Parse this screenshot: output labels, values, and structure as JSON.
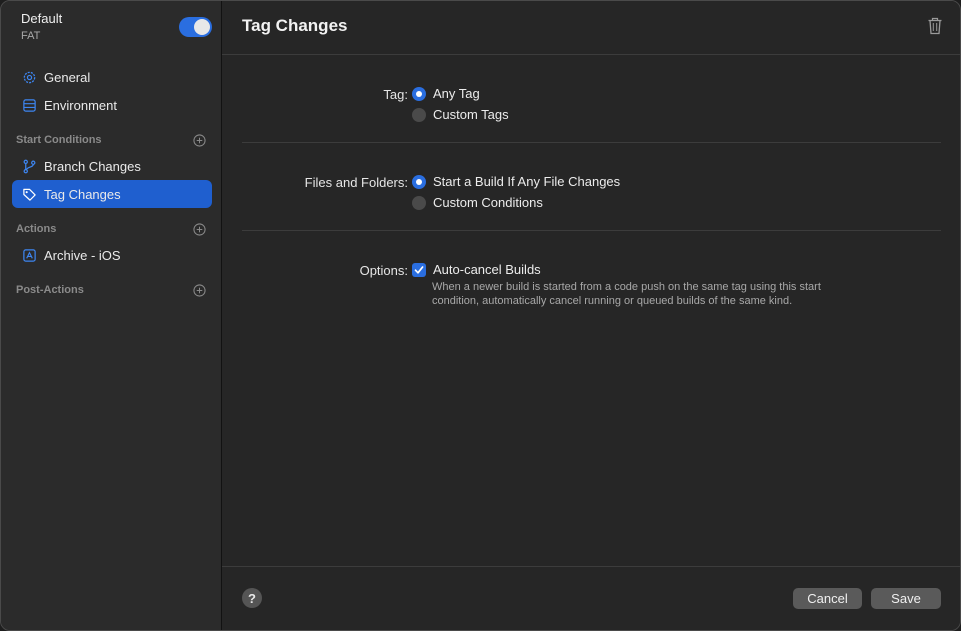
{
  "workflow": {
    "name": "Default",
    "subtitle": "FAT",
    "enabled": true
  },
  "sidebar": {
    "top_items": [
      {
        "label": "General",
        "icon": "gear-icon"
      },
      {
        "label": "Environment",
        "icon": "environment-icon"
      }
    ],
    "sections": [
      {
        "title": "Start Conditions",
        "items": [
          {
            "label": "Branch Changes",
            "icon": "branch-icon"
          },
          {
            "label": "Tag Changes",
            "icon": "tag-icon",
            "selected": true
          }
        ]
      },
      {
        "title": "Actions",
        "items": [
          {
            "label": "Archive - iOS",
            "icon": "archive-icon"
          }
        ]
      },
      {
        "title": "Post-Actions",
        "items": []
      }
    ]
  },
  "main": {
    "title": "Tag Changes",
    "tag": {
      "label": "Tag:",
      "options": [
        {
          "label": "Any Tag",
          "selected": true
        },
        {
          "label": "Custom Tags",
          "selected": false
        }
      ]
    },
    "files": {
      "label": "Files and Folders:",
      "options": [
        {
          "label": "Start a Build If Any File Changes",
          "selected": true
        },
        {
          "label": "Custom Conditions",
          "selected": false
        }
      ]
    },
    "options": {
      "label": "Options:",
      "checkbox_label": "Auto-cancel Builds",
      "checked": true,
      "help_line1": "When a newer build is started from a code push on the same tag using this start",
      "help_line2": "condition, automatically cancel running or queued builds of the same kind."
    }
  },
  "footer": {
    "help": "?",
    "cancel": "Cancel",
    "save": "Save"
  },
  "colors": {
    "accent": "#2a6ee0",
    "selection": "#1f5fcf"
  }
}
